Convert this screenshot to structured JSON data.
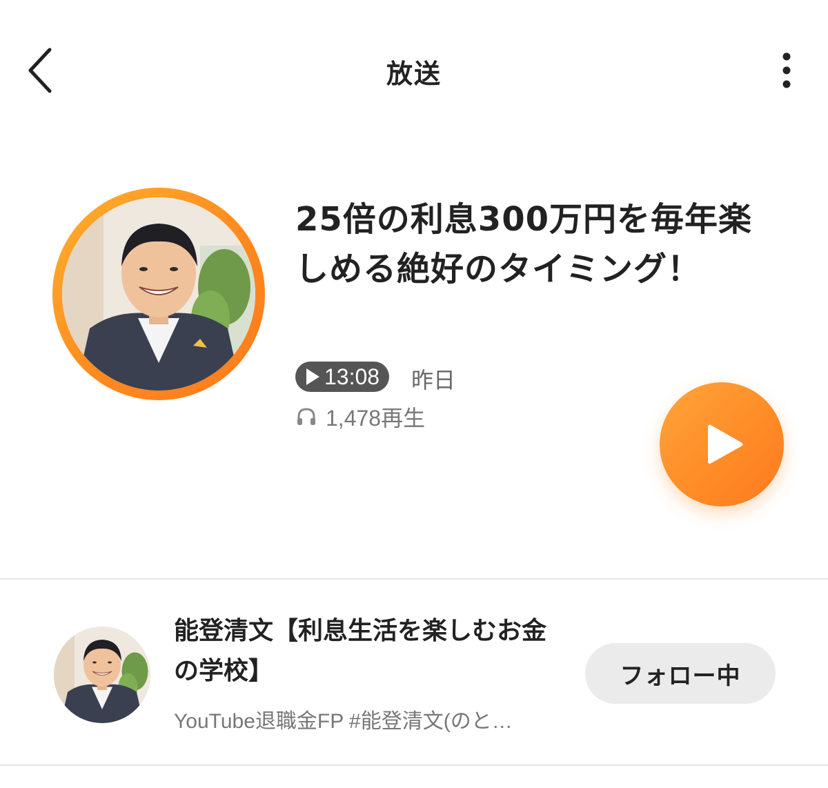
{
  "header": {
    "title": "放送",
    "back_icon": "chevron-left-icon",
    "more_icon": "more-vertical-icon"
  },
  "episode": {
    "title": "25倍の利息300万円を毎年楽しめる絶好のタイミング！",
    "duration": "13:08",
    "date": "昨日",
    "play_count": "1,478再生",
    "play_icon": "play-icon",
    "headphone_icon": "headphone-icon"
  },
  "channel": {
    "name": "能登清文【利息生活を楽しむお金の学校】",
    "description": "YouTube退職金FP #能登清文(のと…",
    "follow_label": "フォロー中"
  },
  "colors": {
    "accent": "#ff8a26",
    "badge": "#555555",
    "follow_bg": "#ebebeb",
    "divider": "#e6e6e6"
  }
}
